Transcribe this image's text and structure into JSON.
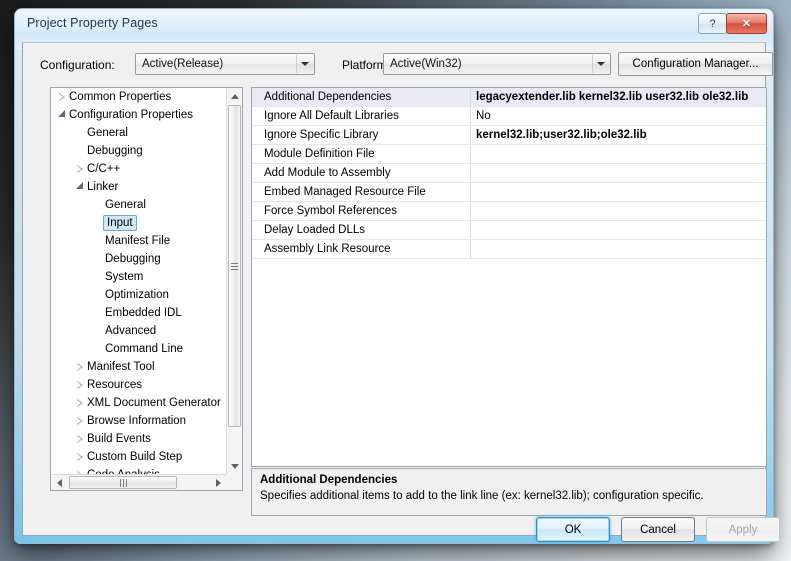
{
  "window": {
    "title": "Project Property Pages",
    "help_label": "?",
    "close_label": "✕"
  },
  "configbar": {
    "configuration_label": "Configuration:",
    "configuration_value": "Active(Release)",
    "platform_label": "Platform:",
    "platform_value": "Active(Win32)",
    "configuration_manager_label": "Configuration Manager..."
  },
  "tree": {
    "items": [
      {
        "label": "Common Properties",
        "indent": 0,
        "toggle": "collapsed",
        "selected": false
      },
      {
        "label": "Configuration Properties",
        "indent": 0,
        "toggle": "expanded",
        "selected": false
      },
      {
        "label": "General",
        "indent": 1,
        "toggle": "none",
        "selected": false
      },
      {
        "label": "Debugging",
        "indent": 1,
        "toggle": "none",
        "selected": false
      },
      {
        "label": "C/C++",
        "indent": 1,
        "toggle": "collapsed",
        "selected": false
      },
      {
        "label": "Linker",
        "indent": 1,
        "toggle": "expanded",
        "selected": false
      },
      {
        "label": "General",
        "indent": 2,
        "toggle": "none",
        "selected": false
      },
      {
        "label": "Input",
        "indent": 2,
        "toggle": "none",
        "selected": true
      },
      {
        "label": "Manifest File",
        "indent": 2,
        "toggle": "none",
        "selected": false
      },
      {
        "label": "Debugging",
        "indent": 2,
        "toggle": "none",
        "selected": false
      },
      {
        "label": "System",
        "indent": 2,
        "toggle": "none",
        "selected": false
      },
      {
        "label": "Optimization",
        "indent": 2,
        "toggle": "none",
        "selected": false
      },
      {
        "label": "Embedded IDL",
        "indent": 2,
        "toggle": "none",
        "selected": false
      },
      {
        "label": "Advanced",
        "indent": 2,
        "toggle": "none",
        "selected": false
      },
      {
        "label": "Command Line",
        "indent": 2,
        "toggle": "none",
        "selected": false
      },
      {
        "label": "Manifest Tool",
        "indent": 1,
        "toggle": "collapsed",
        "selected": false
      },
      {
        "label": "Resources",
        "indent": 1,
        "toggle": "collapsed",
        "selected": false
      },
      {
        "label": "XML Document Generator",
        "indent": 1,
        "toggle": "collapsed",
        "selected": false
      },
      {
        "label": "Browse Information",
        "indent": 1,
        "toggle": "collapsed",
        "selected": false
      },
      {
        "label": "Build Events",
        "indent": 1,
        "toggle": "collapsed",
        "selected": false
      },
      {
        "label": "Custom Build Step",
        "indent": 1,
        "toggle": "collapsed",
        "selected": false
      },
      {
        "label": "Code Analysis",
        "indent": 1,
        "toggle": "collapsed",
        "selected": false
      }
    ]
  },
  "grid": {
    "rows": [
      {
        "name": "Additional Dependencies",
        "value": "legacyextender.lib kernel32.lib user32.lib ole32.lib",
        "bold": true,
        "selected": true
      },
      {
        "name": "Ignore All Default Libraries",
        "value": "No",
        "bold": false,
        "selected": false
      },
      {
        "name": "Ignore Specific Library",
        "value": "kernel32.lib;user32.lib;ole32.lib",
        "bold": true,
        "selected": false
      },
      {
        "name": "Module Definition File",
        "value": "",
        "bold": false,
        "selected": false
      },
      {
        "name": "Add Module to Assembly",
        "value": "",
        "bold": false,
        "selected": false
      },
      {
        "name": "Embed Managed Resource File",
        "value": "",
        "bold": false,
        "selected": false
      },
      {
        "name": "Force Symbol References",
        "value": "",
        "bold": false,
        "selected": false
      },
      {
        "name": "Delay Loaded DLLs",
        "value": "",
        "bold": false,
        "selected": false
      },
      {
        "name": "Assembly Link Resource",
        "value": "",
        "bold": false,
        "selected": false
      }
    ]
  },
  "description": {
    "title": "Additional Dependencies",
    "body": "Specifies additional items to add to the link line (ex: kernel32.lib); configuration specific."
  },
  "footer": {
    "ok_label": "OK",
    "cancel_label": "Cancel",
    "apply_label": "Apply"
  },
  "colors": {
    "selection_blue": "#cfe9f9",
    "row_selection": "#e8e9f5",
    "default_button_border": "#2c8fd1",
    "close_button_red": "#d4523f"
  }
}
